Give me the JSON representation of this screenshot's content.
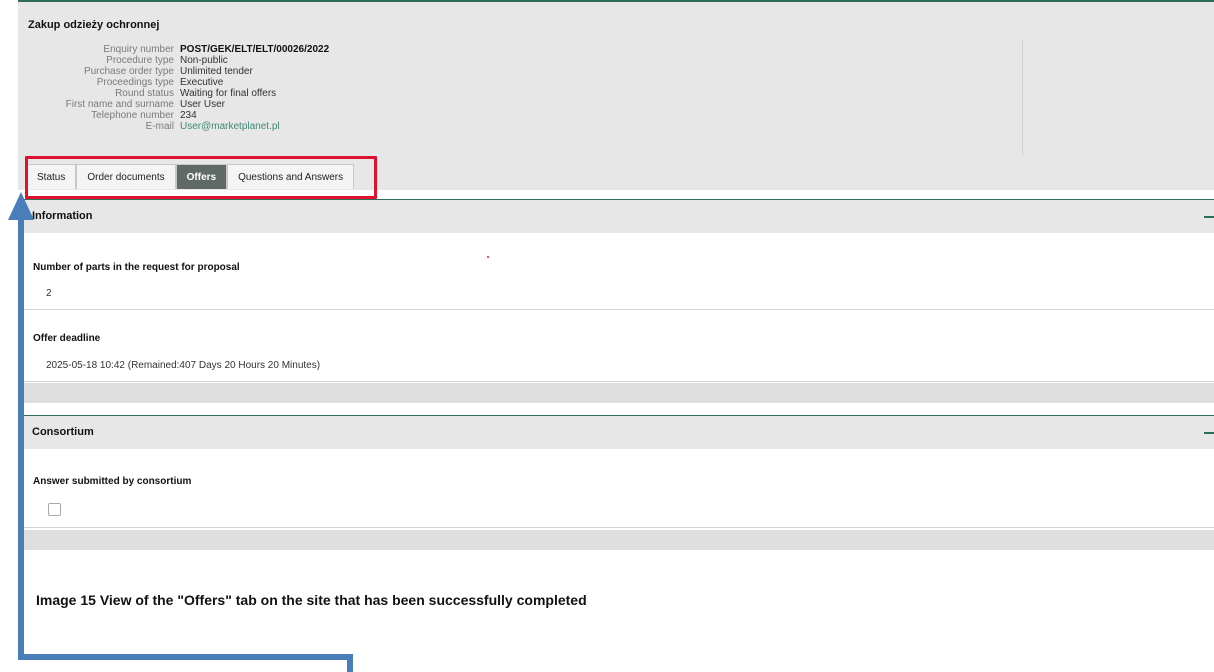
{
  "header": {
    "title": "Zakup odzieży ochronnej",
    "details": [
      {
        "label": "Enquiry number",
        "value": "POST/GEK/ELT/ELT/00026/2022",
        "style": "strong"
      },
      {
        "label": "Procedure type",
        "value": "Non-public",
        "style": "normal"
      },
      {
        "label": "Purchase order type",
        "value": "Unlimited tender",
        "style": "normal"
      },
      {
        "label": "Proceedings type",
        "value": "Executive",
        "style": "normal"
      },
      {
        "label": "Round status",
        "value": "Waiting for final offers",
        "style": "normal"
      },
      {
        "label": "First name and surname",
        "value": "User User",
        "style": "normal"
      },
      {
        "label": "Telephone number",
        "value": "234",
        "style": "normal"
      },
      {
        "label": "E-mail",
        "value": "User@marketplanet.pl",
        "style": "link"
      }
    ]
  },
  "tabs": [
    {
      "label": "Status",
      "active": false
    },
    {
      "label": "Order documents",
      "active": false
    },
    {
      "label": "Offers",
      "active": true
    },
    {
      "label": "Questions and Answers",
      "active": false
    }
  ],
  "information": {
    "title": "Information",
    "parts_label": "Number of parts in the request for proposal",
    "parts_value": "2",
    "deadline_label": "Offer deadline",
    "deadline_value": "2025-05-18 10:42 (Remained:407 Days 20 Hours 20 Minutes)"
  },
  "consortium": {
    "title": "Consortium",
    "answer_label": "Answer submitted by consortium",
    "answer_checked": false
  },
  "caption": "Image 15 View of the \"Offers\" tab on the site that has been successfully completed",
  "colors": {
    "accent_green": "#2f6d57",
    "highlight_red": "#e0112f",
    "annotation_blue": "#4a7ebb",
    "active_tab": "#5f6a66"
  }
}
